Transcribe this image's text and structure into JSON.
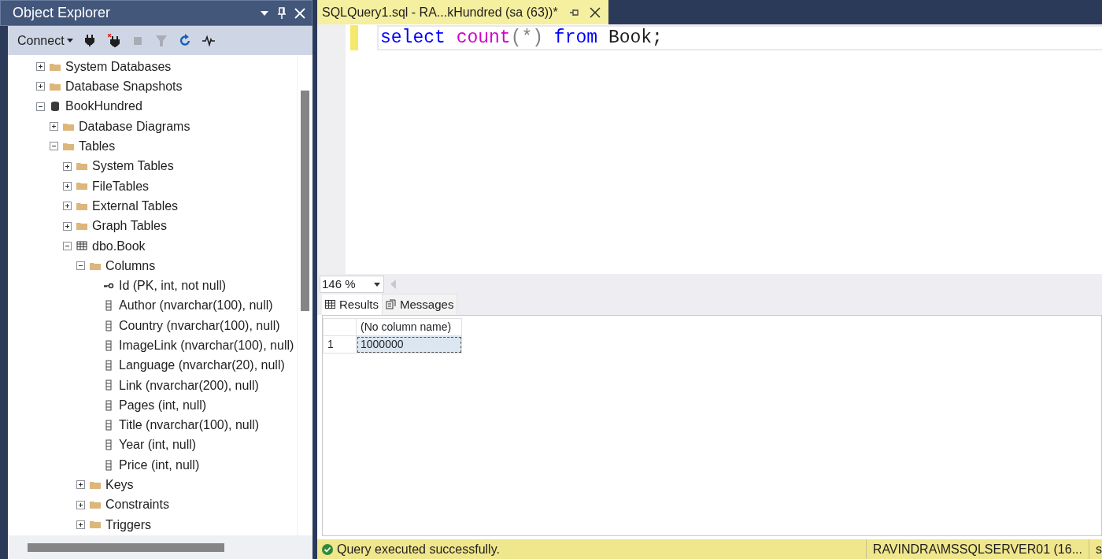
{
  "object_explorer": {
    "title": "Object Explorer",
    "connect_label": "Connect",
    "tools": [
      {
        "disabled": false
      },
      {
        "disabled": false
      },
      {
        "disabled": true
      },
      {
        "disabled": true
      },
      {
        "disabled": false
      },
      {
        "disabled": false
      }
    ],
    "tree": [
      {
        "kind": "folder",
        "label": "System Databases",
        "expanded": false
      },
      {
        "kind": "folder",
        "label": "Database Snapshots",
        "expanded": false
      },
      {
        "kind": "database",
        "label": "BookHundred",
        "expanded": true,
        "children": [
          {
            "kind": "folder",
            "label": "Database Diagrams",
            "expanded": false
          },
          {
            "kind": "folder",
            "label": "Tables",
            "expanded": true,
            "children": [
              {
                "kind": "folder",
                "label": "System Tables",
                "expanded": false
              },
              {
                "kind": "folder",
                "label": "FileTables",
                "expanded": false
              },
              {
                "kind": "folder",
                "label": "External Tables",
                "expanded": false
              },
              {
                "kind": "folder",
                "label": "Graph Tables",
                "expanded": false
              },
              {
                "kind": "table",
                "label": "dbo.Book",
                "expanded": true,
                "children": [
                  {
                    "kind": "folder",
                    "label": "Columns",
                    "expanded": true,
                    "children": [
                      {
                        "kind": "key",
                        "label": "Id (PK, int, not null)"
                      },
                      {
                        "kind": "column",
                        "label": "Author (nvarchar(100), null)"
                      },
                      {
                        "kind": "column",
                        "label": "Country (nvarchar(100), null)"
                      },
                      {
                        "kind": "column",
                        "label": "ImageLink (nvarchar(100), null)"
                      },
                      {
                        "kind": "column",
                        "label": "Language (nvarchar(20), null)"
                      },
                      {
                        "kind": "column",
                        "label": "Link (nvarchar(200), null)"
                      },
                      {
                        "kind": "column",
                        "label": "Pages (int, null)"
                      },
                      {
                        "kind": "column",
                        "label": "Title (nvarchar(100), null)"
                      },
                      {
                        "kind": "column",
                        "label": "Year (int, null)"
                      },
                      {
                        "kind": "column",
                        "label": "Price (int, null)"
                      }
                    ]
                  },
                  {
                    "kind": "folder",
                    "label": "Keys",
                    "expanded": false
                  },
                  {
                    "kind": "folder",
                    "label": "Constraints",
                    "expanded": false
                  },
                  {
                    "kind": "folder",
                    "label": "Triggers",
                    "expanded": false
                  }
                ]
              }
            ]
          }
        ]
      }
    ]
  },
  "editor": {
    "tab_title": "SQLQuery1.sql - RA...kHundred (sa (63))*",
    "code": [
      {
        "kind": "keyword",
        "text": "select "
      },
      {
        "kind": "function",
        "text": "count"
      },
      {
        "kind": "operator",
        "text": "(*) "
      },
      {
        "kind": "keyword",
        "text": "from"
      },
      {
        "kind": "plain",
        "text": " Book;"
      }
    ],
    "zoom": "146 %"
  },
  "results": {
    "tabs": [
      {
        "label": "Results",
        "selected": true
      },
      {
        "label": "Messages",
        "selected": false
      }
    ],
    "columns": [
      "(No column name)"
    ],
    "rows": [
      {
        "number": "1",
        "cells": [
          {
            "text": "1000000",
            "selected": true
          }
        ]
      }
    ]
  },
  "status_bar": {
    "message": "Query executed successfully.",
    "server": "RAVINDRA\\MSSQLSERVER01 (16...",
    "column_3": "s"
  }
}
